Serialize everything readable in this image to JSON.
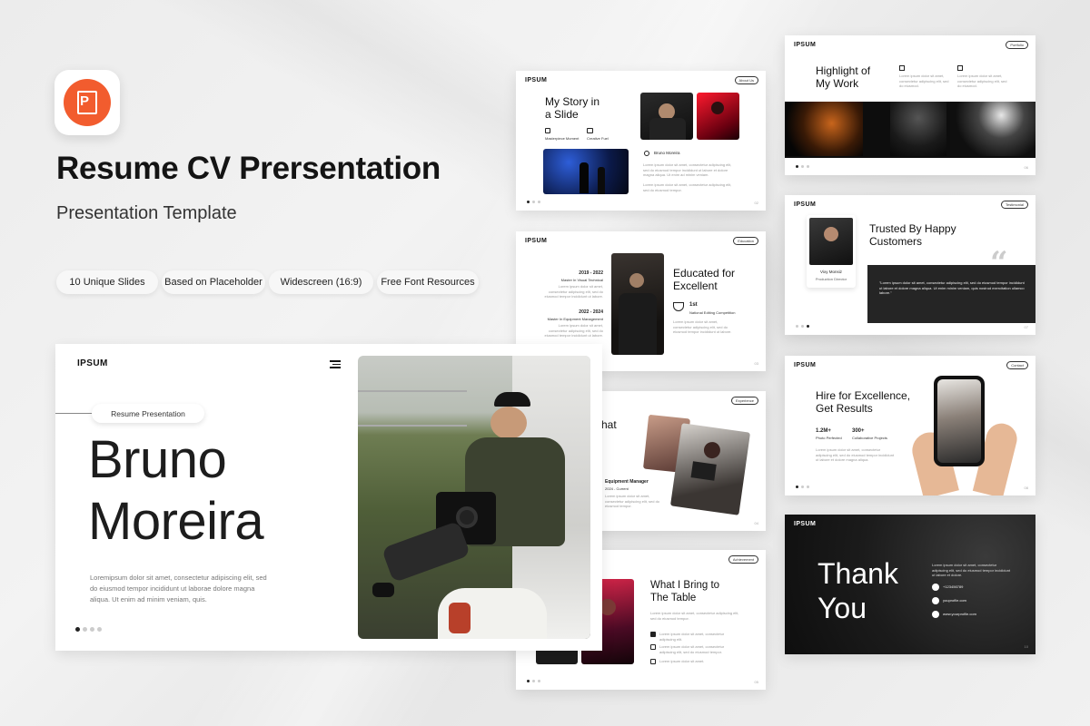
{
  "app_icon": {
    "name": "powerpoint-icon",
    "letter": "P",
    "color": "#f25c2e"
  },
  "title": "Resume CV Prersentation",
  "subtitle": "Presentation Template",
  "features": [
    "10 Unique Slides",
    "Based on Placeholder",
    "Widescreen (16:9)",
    "Free Font Resources"
  ],
  "main_slide": {
    "logo": "IPSUM",
    "tag": "Resume Presentation",
    "name_line1": "Bruno",
    "name_line2": "Moreira",
    "body": "Loremipsum dolor sit amet, consectetur adipiscing elit, sed do eiusmod tempor incididunt ut laborae dolore magna aliqua. Ut enim ad minim veniam, quis."
  },
  "story_slide": {
    "logo": "IPSUM",
    "tag": "About Us",
    "heading_line1": "My Story in",
    "heading_line2": "a Slide",
    "icon1_label": "Masterpiece Moment",
    "icon2_label": "Creative Fuel",
    "person": "Bruno Moreira",
    "text1": "Lorem ipsum dolor sit amet, consectetur adipiscing elit, sed do eiusmod tempor incididunt ut labore et dolore magna aliqua. Ut enim ad minim veniam.",
    "text2": "Lorem ipsum dolor sit amet, consectetur adipiscing elit, sed do eiusmod tempor.",
    "page": "02"
  },
  "education_slide": {
    "logo": "IPSUM",
    "tag": "Education",
    "year1": "2019 - 2022",
    "degree1": "Master In Visual Technical",
    "year2": "2022 - 2024",
    "degree2": "Master In Equipment Management",
    "small_text": "Lorem ipsum dolor sit amet, consectetur adipiscing elit, sed do eiusmod tempor incididunt ut labore.",
    "heading_line1": "Educated for",
    "heading_line2": "Excellent",
    "award_rank": "1st",
    "award_label": "National Editing Competition",
    "award_text": "Lorem ipsum dolor sit amet, consectetur adipiscing elit, sed do eiusmod tempor incididunt ut labore.",
    "page": "03"
  },
  "experience_slide": {
    "tag": "Experience",
    "heading_fragment": "hat",
    "role": "Equipment Manager",
    "period": "2024 - Current",
    "text": "Lorem ipsum dolor sit amet, consectetur adipiscing elit, sed do eiusmod tempor.",
    "page": "04"
  },
  "achievement_slide": {
    "tag": "Achievement",
    "heading_line1": "What I Bring to",
    "heading_line2": "The Table",
    "intro": "Lorem ipsum dolor sit amet, consectetur adipiscing elit, sed do eiusmod tempor.",
    "items": [
      "Lorem ipsum dolor sit amet, consectetur adipiscing elit.",
      "Lorem ipsum dolor sit amet, consectetur adipiscing elit, sed do eiusmod tempor.",
      "Lorem ipsum dolor sit amet."
    ],
    "page": "05"
  },
  "portfolio_slide": {
    "logo": "IPSUM",
    "tag": "Portfolio",
    "heading_line1": "Highlight of",
    "heading_line2": "My Work",
    "text1": "Lorem ipsum dolor sit amet, consectetur adipiscing elit, sed do eiusmod.",
    "text2": "Lorem ipsum dolor sit amet, consectetur adipiscing elit, sed do eiusmod.",
    "page": "06"
  },
  "testimonial_slide": {
    "logo": "IPSUM",
    "tag": "Testimonial",
    "heading_line1": "Trusted By Happy",
    "heading_line2": "Customers",
    "person": "Vixy Monsiz",
    "role": "Production Director",
    "quote": "\"Lorem ipsum dolor sit amet, consectetur adipiscing elit, sed do eiusmod tempor incididunt ut labore et dolore magna aliqua. Ut enim minim veniam, quis nostrud exercitation ullamco labore.\"",
    "page": "07"
  },
  "contact_slide": {
    "logo": "IPSUM",
    "tag": "Contact",
    "heading_line1": "Hire for Excellence,",
    "heading_line2": "Get Results",
    "stat1_value": "1.2M+",
    "stat1_label": "Photo Perfected",
    "stat2_value": "300+",
    "stat2_label": "Collaborative Projects",
    "text": "Lorem ipsum dolor sit amet, consectetur adipiscing elit, sed do eiusmod tempor incididunt ut labore et dolore magna aliqua.",
    "page": "08"
  },
  "thanks_slide": {
    "logo": "IPSUM",
    "line1": "Thank",
    "line2": "You",
    "text": "Lorem ipsum dolor sit amet, consectetur adipiscing elit, sed do eiusmod tempor incididunt ut labore et dolore.",
    "phone": "+123456789",
    "email": "youprofile.com",
    "web": "www.yourprofile.com",
    "page": "10"
  }
}
